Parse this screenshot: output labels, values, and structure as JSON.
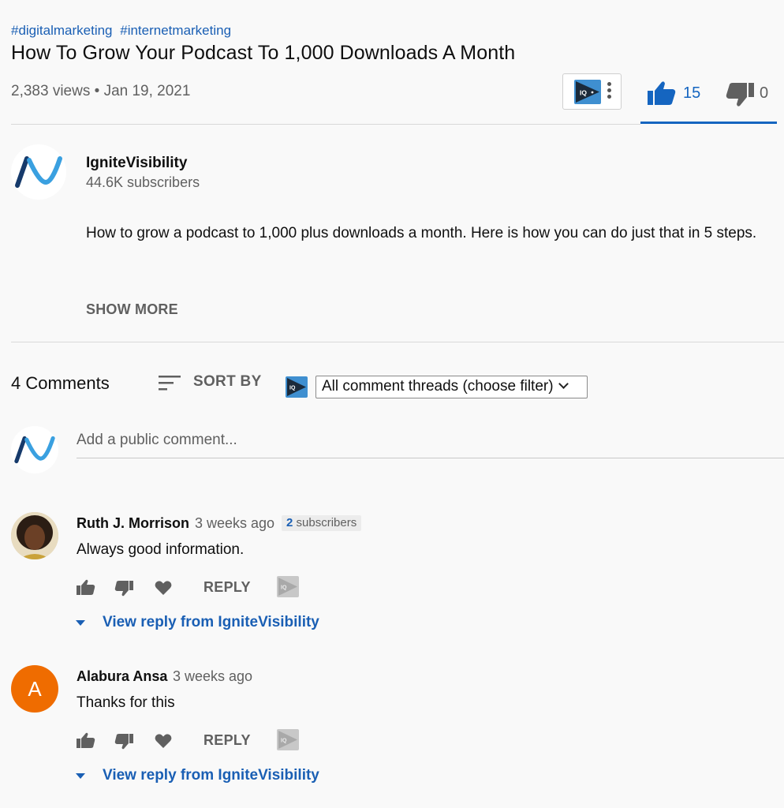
{
  "video": {
    "hashtags": [
      "#digitalmarketing",
      "#internetmarketing"
    ],
    "title": "How To Grow Your Podcast To 1,000 Downloads A Month",
    "views": "2,383 views",
    "separator": "•",
    "date": "Jan 19, 2021",
    "likes": "15",
    "dislikes": "0"
  },
  "extension": {
    "badge_text": "IQ",
    "icon": "iq-extension-icon"
  },
  "channel": {
    "name": "IgniteVisibility",
    "subscribers": "44.6K subscribers",
    "description": "How to grow a podcast to 1,000 plus downloads a month. Here is how you can do just that in 5 steps.",
    "show_more": "SHOW MORE"
  },
  "comments_header": {
    "count": "4 Comments",
    "sort_label": "SORT BY",
    "filter_value": "All comment threads (choose filter)",
    "add_placeholder": "Add a public comment..."
  },
  "comments": [
    {
      "author": "Ruth J. Morrison",
      "time": "3 weeks ago",
      "subs_count": "2",
      "subs_label": "subscribers",
      "text": "Always good information.",
      "reply_label": "REPLY",
      "view_reply": "View reply from IgniteVisibility"
    },
    {
      "author": "Alabura Ansa",
      "avatar_letter": "A",
      "time": "3 weeks ago",
      "text": "Thanks for this",
      "reply_label": "REPLY",
      "view_reply": "View reply from IgniteVisibility"
    }
  ],
  "colors": {
    "link_blue": "#1a5fb4",
    "like_blue": "#1565c0",
    "avatar_orange": "#ef6c00",
    "iq_blue": "#3f8fd0"
  }
}
